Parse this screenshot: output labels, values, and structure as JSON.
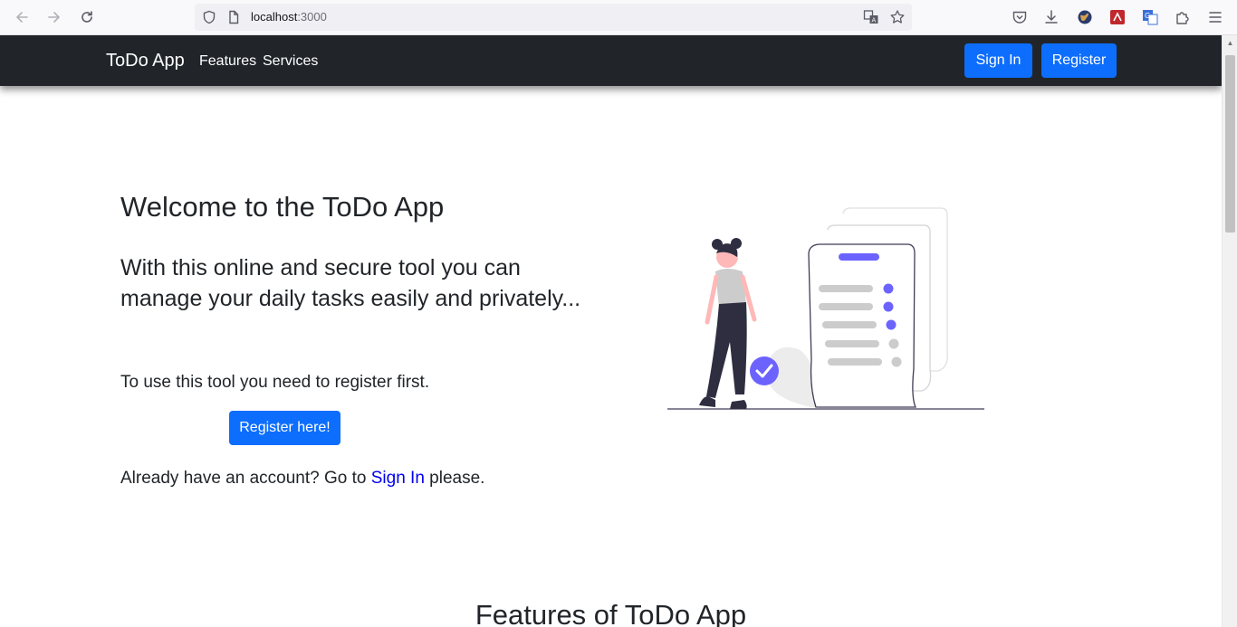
{
  "browser": {
    "url_host": "localhost",
    "url_port": ":3000"
  },
  "navbar": {
    "brand": "ToDo App",
    "links": [
      "Features",
      "Services"
    ],
    "signin_label": "Sign In",
    "register_label": "Register"
  },
  "hero": {
    "title": "Welcome to the ToDo App",
    "lead": "With this online and secure tool you can manage your daily tasks easily and privately...",
    "register_note": "To use this tool you need to register first.",
    "register_button": "Register here!",
    "signin_prefix": "Already have an account? Go to ",
    "signin_link": "Sign In",
    "signin_suffix": " please."
  },
  "features": {
    "title": "Features of ToDo App"
  },
  "colors": {
    "primary": "#0d6efd",
    "navbar_bg": "#212529",
    "illustration_accent": "#6c63ff"
  }
}
